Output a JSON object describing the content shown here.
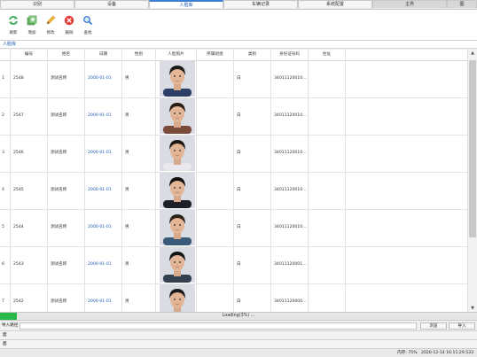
{
  "tabs": [
    {
      "label": "识别",
      "active": false
    },
    {
      "label": "设备",
      "active": false
    },
    {
      "label": "人脸库",
      "active": true
    },
    {
      "label": "车辆记录",
      "active": false
    },
    {
      "label": "系统配置",
      "active": false
    },
    {
      "label": "主界",
      "active": false
    },
    {
      "label": "图",
      "active": false
    }
  ],
  "toolbar": {
    "refresh": "刷新",
    "add": "增加",
    "edit": "修改",
    "delete": "删除",
    "search": "查找"
  },
  "section_label": "人脸库",
  "table": {
    "headers": [
      "编号",
      "姓名",
      "日期",
      "性别",
      "人脸照片",
      "所属组组",
      "类别",
      "身份证号码",
      "住址"
    ],
    "rows": [
      {
        "index": "1",
        "id": "2548",
        "name": "测试名称",
        "date": "2000-01-01",
        "gender": "男",
        "type": "白",
        "idno": "34011120010..."
      },
      {
        "index": "2",
        "id": "2547",
        "name": "测试名称",
        "date": "2000-01-01",
        "gender": "男",
        "type": "白",
        "idno": "34011120010..."
      },
      {
        "index": "3",
        "id": "2546",
        "name": "测试名称",
        "date": "2000-01-01",
        "gender": "男",
        "type": "白",
        "idno": "34011120010..."
      },
      {
        "index": "4",
        "id": "2545",
        "name": "测试名称",
        "date": "2000-01-01",
        "gender": "男",
        "type": "白",
        "idno": "34011120010..."
      },
      {
        "index": "5",
        "id": "2544",
        "name": "测试名称",
        "date": "2000-01-01",
        "gender": "男",
        "type": "白",
        "idno": "34011120010..."
      },
      {
        "index": "6",
        "id": "2543",
        "name": "测试名称",
        "date": "2000-01-01",
        "gender": "男",
        "type": "白",
        "idno": "34011120001..."
      },
      {
        "index": "7",
        "id": "2542",
        "name": "测试名称",
        "date": "2000-01-01",
        "gender": "男",
        "type": "白",
        "idno": "34011120000..."
      }
    ]
  },
  "progress": {
    "text": "Loading(3%) ...",
    "fraction": 0.035
  },
  "import": {
    "label": "导入路径",
    "browse": "浏览",
    "import": "导入",
    "value": ""
  },
  "lines": [
    "面",
    "面"
  ],
  "status": {
    "memory": "内存: 75%",
    "datetime": "2020-12-14 16:11:29.533"
  }
}
